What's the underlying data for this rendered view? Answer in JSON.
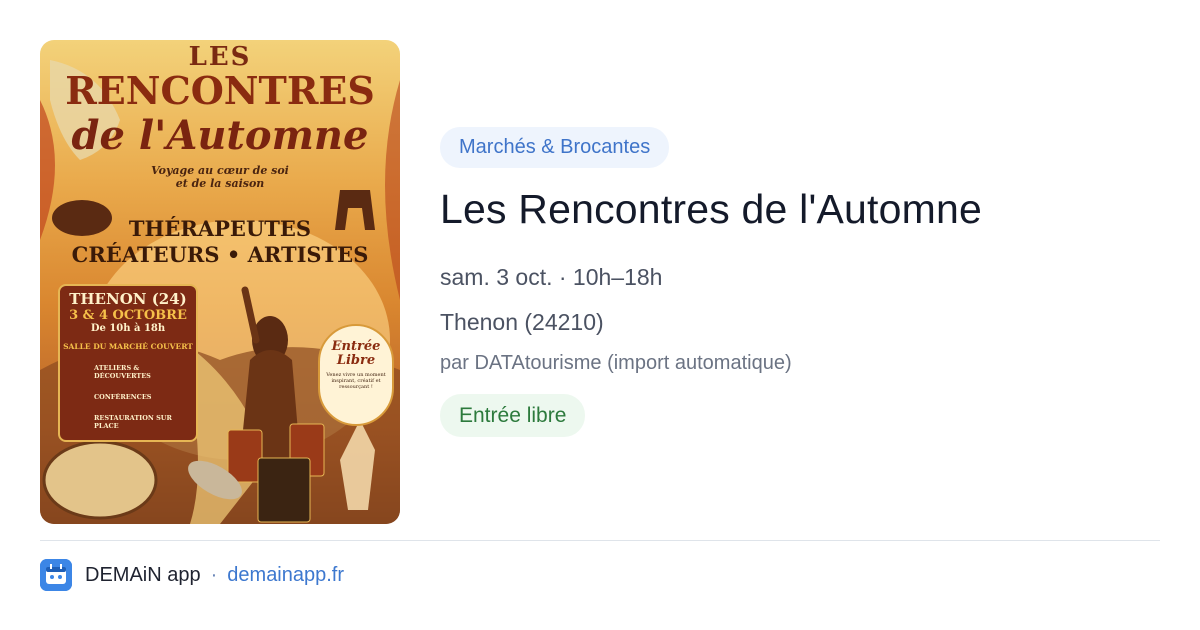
{
  "poster": {
    "alt": "Les Rencontres de l'Automne poster",
    "les": "LES",
    "rencontres": "RENCONTRES",
    "automne": "de l'Automne",
    "voyage_line1": "Voyage au cœur de soi",
    "voyage_line2": "et de la saison",
    "therapeutes": "THÉRAPEUTES",
    "createurs": "CRÉATEURS • ARTISTES",
    "city": "THENON (24)",
    "dates": "3 & 4 OCTOBRE",
    "hours": "De 10h à 18h",
    "salle": "SALLE DU MARCHÉ COUVERT",
    "items": [
      "ATELIERS & DÉCOUVERTES",
      "CONFÉRENCES",
      "RESTAURATION SUR PLACE"
    ],
    "entree": "Entrée Libre",
    "entree_sub": "Venez vivre un moment inspirant, créatif et ressourçant !"
  },
  "event": {
    "category": "Marchés & Brocantes",
    "title": "Les Rencontres de l'Automne",
    "when": "sam. 3 oct. · 10h–18h",
    "location": "Thenon (24210)",
    "author": "par DATAtourisme (import automatique)",
    "price": "Entrée libre"
  },
  "footer": {
    "app_name": "DEMAiN app",
    "separator": "·",
    "url": "demainapp.fr"
  },
  "colors": {
    "badge_bg": "#eef4fd",
    "badge_text": "#3f74c9",
    "free_bg": "#edf8ef",
    "free_text": "#2c7a3c",
    "app_icon": "#3c86e6"
  }
}
